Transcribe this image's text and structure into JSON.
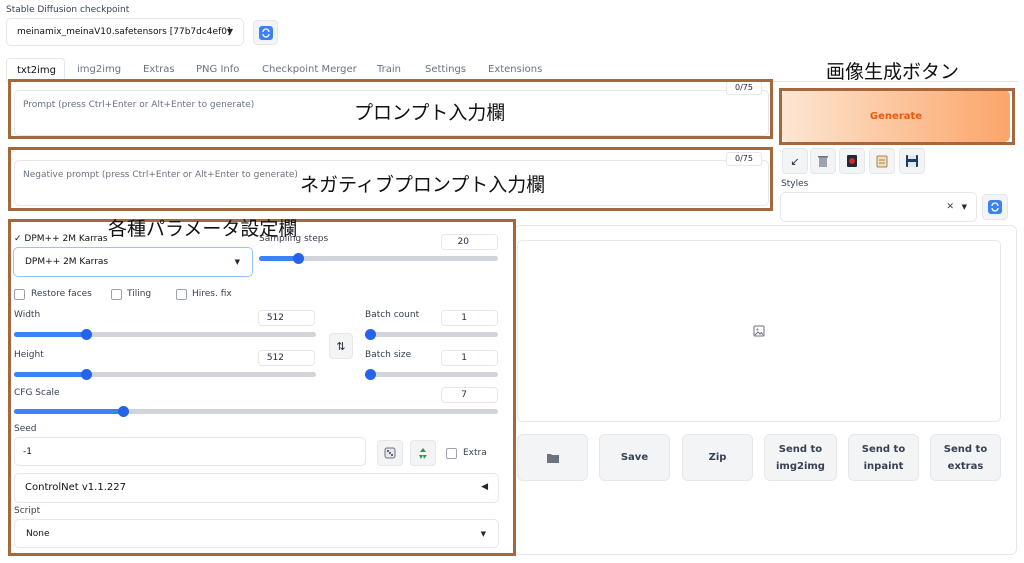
{
  "header": {
    "checkpoint_label": "Stable Diffusion checkpoint",
    "checkpoint_value": "meinamix_meinaV10.safetensors [77b7dc4ef0]"
  },
  "tabs": [
    {
      "label": "txt2img",
      "active": true
    },
    {
      "label": "img2img"
    },
    {
      "label": "Extras"
    },
    {
      "label": "PNG Info"
    },
    {
      "label": "Checkpoint Merger"
    },
    {
      "label": "Train"
    },
    {
      "label": "Settings"
    },
    {
      "label": "Extensions"
    }
  ],
  "prompt": {
    "placeholder": "Prompt (press Ctrl+Enter or Alt+Enter to generate)",
    "token_count": "0/75"
  },
  "negative_prompt": {
    "placeholder": "Negative prompt (press Ctrl+Enter or Alt+Enter to generate)",
    "token_count": "0/75"
  },
  "generate": {
    "label": "Generate"
  },
  "styles": {
    "label": "Styles"
  },
  "sampler": {
    "dropdown_header": "✓ DPM++ 2M Karras",
    "value": "DPM++ 2M Karras"
  },
  "sampling_steps": {
    "label": "Sampling steps",
    "value": "20",
    "fraction": 0.15
  },
  "options": {
    "restore_faces": "Restore faces",
    "tiling": "Tiling",
    "hires_fix": "Hires. fix",
    "extra": "Extra"
  },
  "width": {
    "label": "Width",
    "value": "512",
    "fraction": 0.23
  },
  "height": {
    "label": "Height",
    "value": "512",
    "fraction": 0.23
  },
  "batch_count": {
    "label": "Batch count",
    "value": "1",
    "fraction": 0.0
  },
  "batch_size": {
    "label": "Batch size",
    "value": "1",
    "fraction": 0.0
  },
  "cfg_scale": {
    "label": "CFG Scale",
    "value": "7",
    "fraction": 0.22
  },
  "seed": {
    "label": "Seed",
    "value": "-1"
  },
  "controlnet": {
    "label": "ControlNet v1.1.227"
  },
  "script": {
    "label": "Script",
    "value": "None"
  },
  "output_buttons": {
    "save": "Save",
    "zip": "Zip",
    "send_img2img": "Send to\nimg2img",
    "send_inpaint": "Send to\ninpaint",
    "send_extras": "Send to\nextras"
  },
  "annotations": {
    "prompt_area": "プロンプト入力欄",
    "negative_area": "ネガティブプロンプト入力欄",
    "params_area": "各種パラメータ設定欄",
    "generate_button": "画像生成ボタン"
  },
  "colors": {
    "accent": "#2563eb",
    "generate_gradient_start": "#fde0c8",
    "generate_gradient_end": "#fba569",
    "generate_text": "#e85a0c",
    "annotation_border": "#a5683e"
  }
}
